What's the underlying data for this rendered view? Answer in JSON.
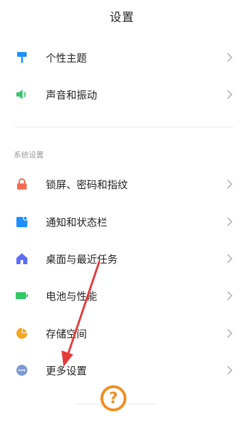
{
  "header": {
    "title": "设置"
  },
  "group1": [
    {
      "label": "个性主题",
      "icon": "paint-roller-icon",
      "color": "#1e8fff"
    },
    {
      "label": "声音和振动",
      "icon": "speaker-icon",
      "color": "#37c46c"
    }
  ],
  "section": {
    "title": "系统设置"
  },
  "group2": [
    {
      "label": "锁屏、密码和指纹",
      "icon": "lock-icon",
      "color": "#f46b52"
    },
    {
      "label": "通知和状态栏",
      "icon": "notification-icon",
      "color": "#1e8fff"
    },
    {
      "label": "桌面与最近任务",
      "icon": "home-icon",
      "color": "#5b6ef5"
    },
    {
      "label": "电池与性能",
      "icon": "battery-icon",
      "color": "#2fc866"
    },
    {
      "label": "存储空间",
      "icon": "pie-chart-icon",
      "color": "#f5a623"
    },
    {
      "label": "更多设置",
      "icon": "more-dots-icon",
      "color": "#7c9ad6"
    }
  ],
  "overlay": {
    "help_glyph": "?"
  },
  "colors": {
    "chevron": "#b5b5b5",
    "annotation_arrow": "#e53a3a",
    "help_badge": "#f28c1e"
  }
}
